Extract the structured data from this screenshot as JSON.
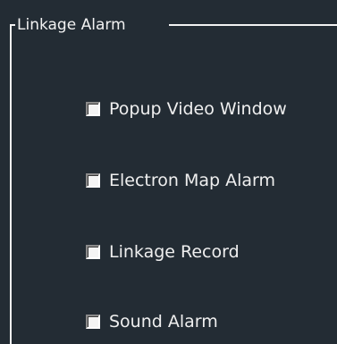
{
  "group": {
    "title": "Linkage Alarm",
    "options": [
      {
        "label": "Popup Video Window",
        "checked": false
      },
      {
        "label": "Electron Map Alarm",
        "checked": false
      },
      {
        "label": "Linkage Record",
        "checked": false
      },
      {
        "label": "Sound Alarm",
        "checked": false
      }
    ]
  }
}
